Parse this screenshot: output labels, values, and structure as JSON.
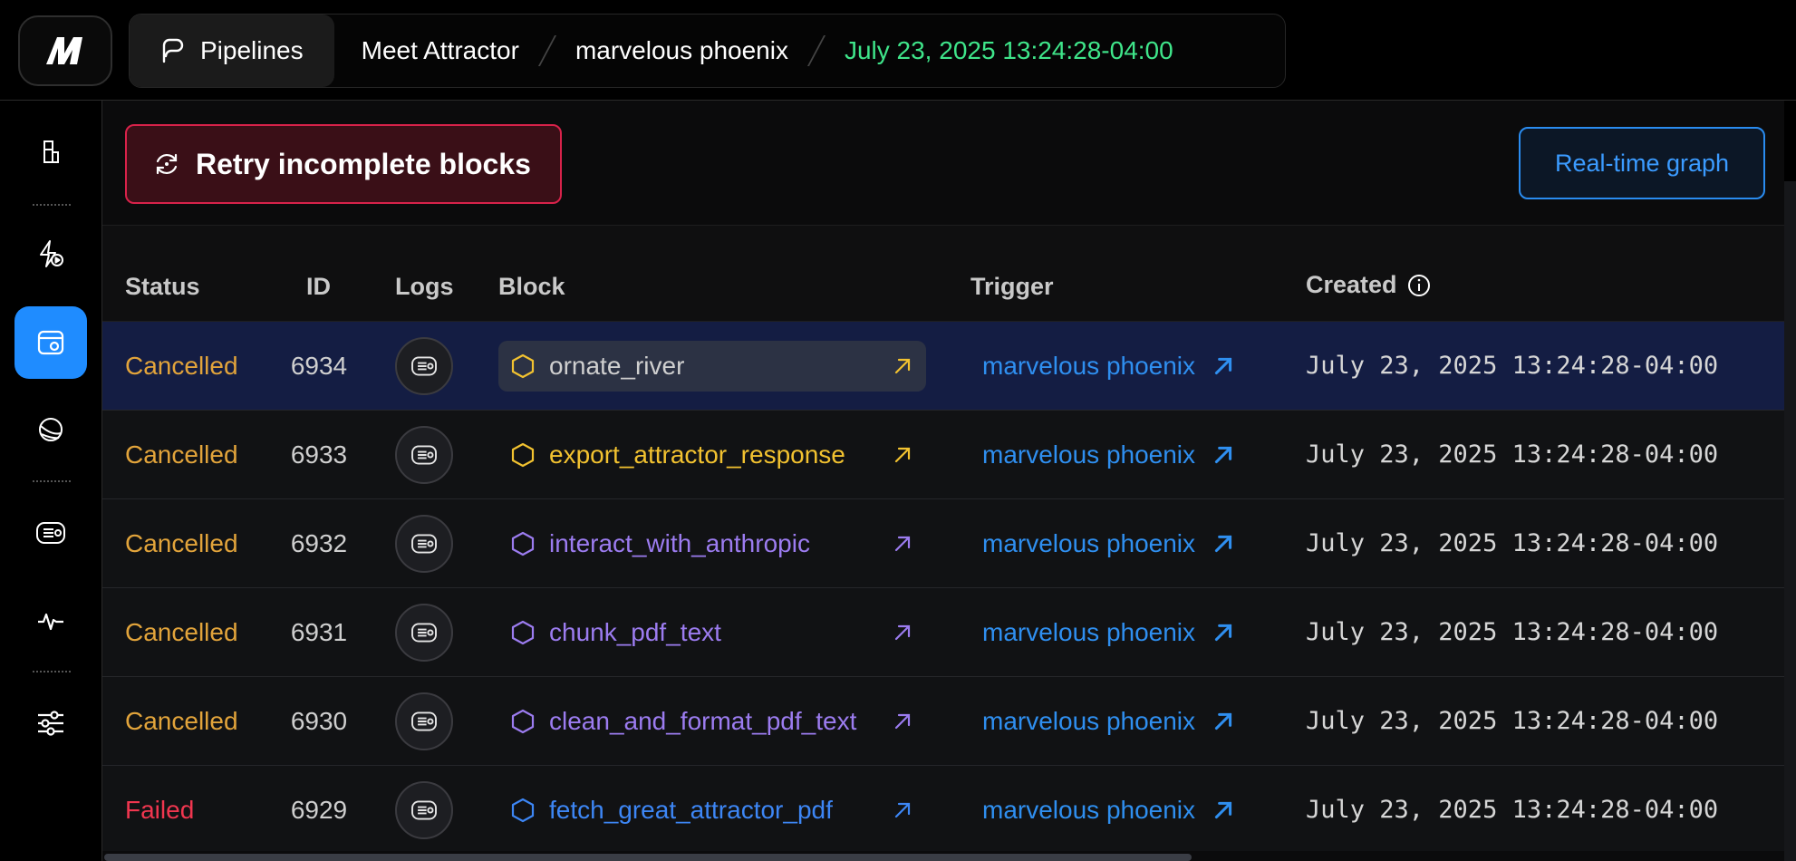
{
  "header": {
    "pipelines_label": "Pipelines",
    "crumbs": [
      "Meet Attractor",
      "marvelous phoenix"
    ],
    "timestamp": "July 23, 2025 13:24:28-04:00"
  },
  "toolbar": {
    "retry_label": "Retry incomplete blocks",
    "graph_label": "Real-time graph"
  },
  "table": {
    "columns": {
      "status": "Status",
      "id": "ID",
      "logs": "Logs",
      "block": "Block",
      "trigger": "Trigger",
      "created": "Created"
    },
    "rows": [
      {
        "status": "Cancelled",
        "id": "6934",
        "block": "ornate_river",
        "trigger": "marvelous phoenix",
        "created": "July 23, 2025 13:24:28-04:00"
      },
      {
        "status": "Cancelled",
        "id": "6933",
        "block": "export_attractor_response",
        "trigger": "marvelous phoenix",
        "created": "July 23, 2025 13:24:28-04:00"
      },
      {
        "status": "Cancelled",
        "id": "6932",
        "block": "interact_with_anthropic",
        "trigger": "marvelous phoenix",
        "created": "July 23, 2025 13:24:28-04:00"
      },
      {
        "status": "Cancelled",
        "id": "6931",
        "block": "chunk_pdf_text",
        "trigger": "marvelous phoenix",
        "created": "July 23, 2025 13:24:28-04:00"
      },
      {
        "status": "Cancelled",
        "id": "6930",
        "block": "clean_and_format_pdf_text",
        "trigger": "marvelous phoenix",
        "created": "July 23, 2025 13:24:28-04:00"
      },
      {
        "status": "Failed",
        "id": "6929",
        "block": "fetch_great_attractor_pdf",
        "trigger": "marvelous phoenix",
        "created": "July 23, 2025 13:24:28-04:00"
      }
    ]
  },
  "colors": {
    "cancelled": "#e2a43b",
    "failed": "#f0364f",
    "timestamp": "#3fe58a",
    "link": "#2f8ff0",
    "active_nav": "#1f8cff"
  }
}
